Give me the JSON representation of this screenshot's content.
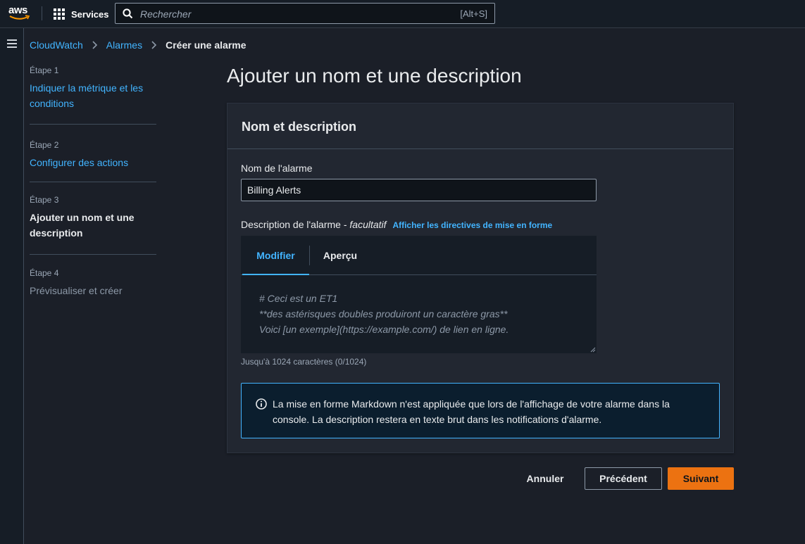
{
  "topnav": {
    "logo_text": "aws",
    "services_label": "Services",
    "search_placeholder": "Rechercher",
    "search_shortcut": "[Alt+S]"
  },
  "breadcrumb": {
    "items": [
      "CloudWatch",
      "Alarmes"
    ],
    "current": "Créer une alarme"
  },
  "steps": [
    {
      "num": "Étape 1",
      "title": "Indiquer la métrique et les conditions",
      "state": "link"
    },
    {
      "num": "Étape 2",
      "title": "Configurer des actions",
      "state": "link"
    },
    {
      "num": "Étape 3",
      "title": "Ajouter un nom et une description",
      "state": "active"
    },
    {
      "num": "Étape 4",
      "title": "Prévisualiser et créer",
      "state": "disabled"
    }
  ],
  "main": {
    "title": "Ajouter un nom et une description",
    "panel_title": "Nom et description",
    "name_label": "Nom de l'alarme",
    "name_value": "Billing Alerts",
    "desc_label": "Description de l'alarme - ",
    "desc_optional": "facultatif",
    "desc_info_link": "Afficher les directives de mise en forme",
    "tabs": [
      "Modifier",
      "Aperçu"
    ],
    "editor_placeholder": [
      "# Ceci est un ET1",
      "**des astérisques doubles produiront un caractère gras**",
      "Voici [un exemple](https://example.com/) de lien en ligne."
    ],
    "hint": "Jusqu'à 1024 caractères (0/1024)",
    "alert_text": "La mise en forme Markdown n'est appliquée que lors de l'affichage de votre alarme dans la console. La description restera en texte brut dans les notifications d'alarme."
  },
  "actions": {
    "cancel": "Annuler",
    "previous": "Précédent",
    "next": "Suivant"
  },
  "colors": {
    "accent_link": "#42b4ff",
    "primary_button": "#ec7211",
    "background": "#1b1f28",
    "panel": "#222731"
  }
}
